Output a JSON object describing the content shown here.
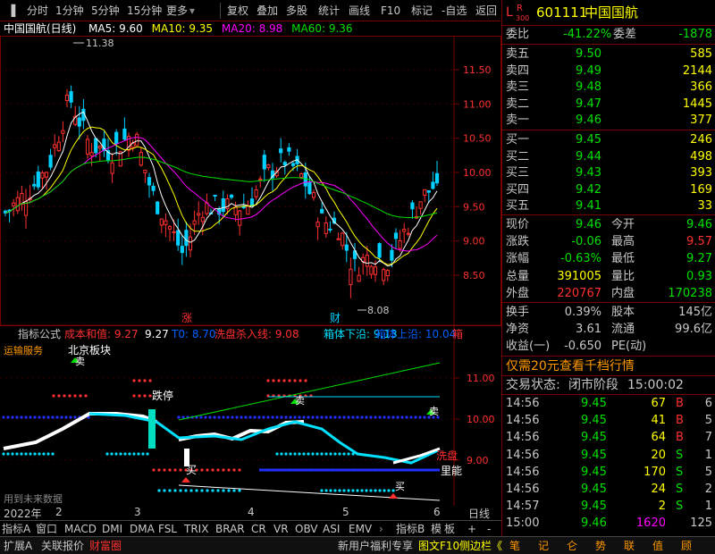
{
  "toolbar": {
    "items": [
      "分时",
      "1分钟",
      "5分钟",
      "15分钟",
      "更多",
      "复权",
      "叠加",
      "多股",
      "统计",
      "画线",
      "F10",
      "标记",
      "-自选",
      "返回"
    ]
  },
  "chart": {
    "title": "中国国航(日线)",
    "ma": [
      {
        "label": "MA5: 9.60",
        "color": "#ffffff"
      },
      {
        "label": "MA10: 9.35",
        "color": "#ffff00"
      },
      {
        "label": "MA20: 8.98",
        "color": "#ff00ff"
      },
      {
        "label": "MA60: 9.36",
        "color": "#00e000"
      }
    ],
    "high_label": "11.38",
    "low_label": "8.08",
    "marker_zhang": "涨",
    "marker_cai": "财",
    "y_ticks": [
      "11.50",
      "11.00",
      "10.50",
      "10.00",
      "9.50",
      "9.00",
      "8.50"
    ]
  },
  "indicator": {
    "title": "指标公式",
    "line1": "成本和值: 9.27",
    "line1b": "9.27",
    "line2": "T0: 8.70",
    "line3": "洗盘杀入线: 9.08",
    "line4": "箱体下沿: 9.13",
    "line5": "箱体上沿: 10.04",
    "line6": "箱",
    "left_label": "运输服务",
    "board_label": "北京板块",
    "label_die": "跌停",
    "label_mai": "卖",
    "label_mai2": "卖",
    "label_buy": "买",
    "label_buy2": "买",
    "label_xipan": "洗盘",
    "label_lifen": "里能",
    "label_tip": "买",
    "label_future": "用到未来数据",
    "y_ticks": [
      "11.00",
      "10.00",
      "9.00"
    ]
  },
  "time_axis": {
    "labels": [
      "2022年",
      "2",
      "3",
      "4",
      "5",
      "6"
    ],
    "period": "日线"
  },
  "tabs": [
    "指标A",
    "窗口",
    "MACD",
    "DMI",
    "DMA",
    "FSL",
    "TRIX",
    "BRAR",
    "CR",
    "VR",
    "OBV",
    "ASI",
    "EMV",
    "指标B",
    "模",
    "板",
    "+",
    "-"
  ],
  "stock": {
    "badge_l": "L",
    "badge_r": "R",
    "badge_num": "300",
    "code": "601111",
    "name": "中国国航"
  },
  "weibi": {
    "label1": "委比",
    "value1": "-41.22%",
    "label2": "委差",
    "value2": "-1878"
  },
  "asks": [
    {
      "label": "卖五",
      "price": "9.50",
      "vol": "585"
    },
    {
      "label": "卖四",
      "price": "9.49",
      "vol": "2144"
    },
    {
      "label": "卖三",
      "price": "9.48",
      "vol": "366"
    },
    {
      "label": "卖二",
      "price": "9.47",
      "vol": "1445"
    },
    {
      "label": "卖一",
      "price": "9.46",
      "vol": "377"
    }
  ],
  "bids": [
    {
      "label": "买一",
      "price": "9.45",
      "vol": "246"
    },
    {
      "label": "买二",
      "price": "9.44",
      "vol": "498"
    },
    {
      "label": "买三",
      "price": "9.43",
      "vol": "393"
    },
    {
      "label": "买四",
      "price": "9.42",
      "vol": "169"
    },
    {
      "label": "买五",
      "price": "9.41",
      "vol": "33"
    }
  ],
  "quote": [
    {
      "l1": "现价",
      "v1": "9.46",
      "l2": "今开",
      "v2": "9.46",
      "c1": "#00e000",
      "c2": "#00e000"
    },
    {
      "l1": "涨跌",
      "v1": "-0.06",
      "l2": "最高",
      "v2": "9.57",
      "c1": "#00e000",
      "c2": "#ff3030"
    },
    {
      "l1": "涨幅",
      "v1": "-0.63%",
      "l2": "最低",
      "v2": "9.27",
      "c1": "#00e000",
      "c2": "#00e000"
    },
    {
      "l1": "总量",
      "v1": "391005",
      "l2": "量比",
      "v2": "0.93",
      "c1": "#ffff00",
      "c2": "#00e000"
    },
    {
      "l1": "外盘",
      "v1": "220767",
      "l2": "内盘",
      "v2": "170238",
      "c1": "#ff3030",
      "c2": "#00e000"
    }
  ],
  "finance": [
    {
      "l1": "换手",
      "v1": "0.39%",
      "l2": "股本",
      "v2": "145亿"
    },
    {
      "l1": "净资",
      "v1": "3.61",
      "l2": "流通",
      "v2": "99.6亿"
    },
    {
      "l1": "收益(一)",
      "v1": "-0.650",
      "l2": "PE(动)",
      "v2": ""
    }
  ],
  "promo": "仅需20元查看千档行情",
  "trade_status": {
    "label": "交易状态:",
    "value": "闭市阶段",
    "time": "15:00:02"
  },
  "ticks": [
    {
      "time": "14:56",
      "price": "9.45",
      "vol": "67",
      "side": "B",
      "n": "6"
    },
    {
      "time": "14:56",
      "price": "9.45",
      "vol": "41",
      "side": "B",
      "n": "5"
    },
    {
      "time": "14:56",
      "price": "9.45",
      "vol": "64",
      "side": "B",
      "n": "7"
    },
    {
      "time": "14:56",
      "price": "9.45",
      "vol": "20",
      "side": "S",
      "n": "1"
    },
    {
      "time": "14:56",
      "price": "9.45",
      "vol": "170",
      "side": "S",
      "n": "5"
    },
    {
      "time": "14:56",
      "price": "9.45",
      "vol": "24",
      "side": "S",
      "n": "2"
    },
    {
      "time": "14:57",
      "price": "9.45",
      "vol": "2",
      "side": "S",
      "n": "1"
    },
    {
      "time": "15:00",
      "price": "9.46",
      "vol": "1620",
      "side": "",
      "n": "125"
    }
  ],
  "bottom_left": [
    "扩展A",
    "关联报价",
    "财富圈"
  ],
  "bottom_right": [
    "新用户福利专享",
    "图文F10",
    "侧边栏《"
  ],
  "bottom_icons": [
    "笔",
    "记",
    "仑",
    "势",
    "联",
    "值",
    "顾"
  ]
}
